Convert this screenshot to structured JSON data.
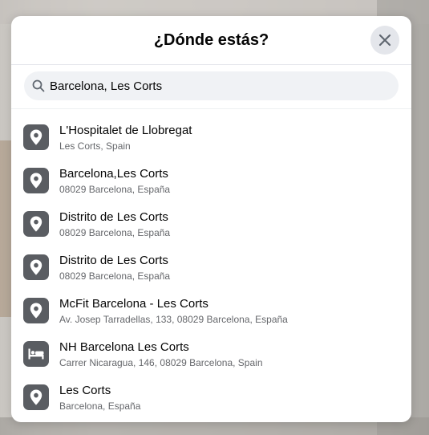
{
  "dialog": {
    "title": "¿Dónde estás?"
  },
  "search": {
    "value": "Barcelona, Les Corts"
  },
  "results": [
    {
      "title": "L'Hospitalet de Llobregat",
      "subtitle": "Les Corts, Spain",
      "icon": "location-pin-icon"
    },
    {
      "title": "Barcelona,Les Corts",
      "subtitle": "08029 Barcelona, España",
      "icon": "location-pin-icon"
    },
    {
      "title": "Distrito de Les Corts",
      "subtitle": "08029 Barcelona, España",
      "icon": "location-pin-icon"
    },
    {
      "title": "Distrito de Les Corts",
      "subtitle": "08029 Barcelona, España",
      "icon": "location-pin-icon"
    },
    {
      "title": "McFit Barcelona - Les Corts",
      "subtitle": "Av. Josep Tarradellas, 133, 08029 Barcelona, España",
      "icon": "location-pin-icon"
    },
    {
      "title": "NH Barcelona Les Corts",
      "subtitle": "Carrer Nicaragua, 146, 08029 Barcelona, Spain",
      "icon": "bed-icon"
    },
    {
      "title": "Les Corts",
      "subtitle": "Barcelona, España",
      "icon": "location-pin-icon"
    }
  ],
  "colors": {
    "icon_tile": "#5a5d62",
    "search_bg": "#f0f2f5",
    "close_bg": "#e4e6eb"
  }
}
